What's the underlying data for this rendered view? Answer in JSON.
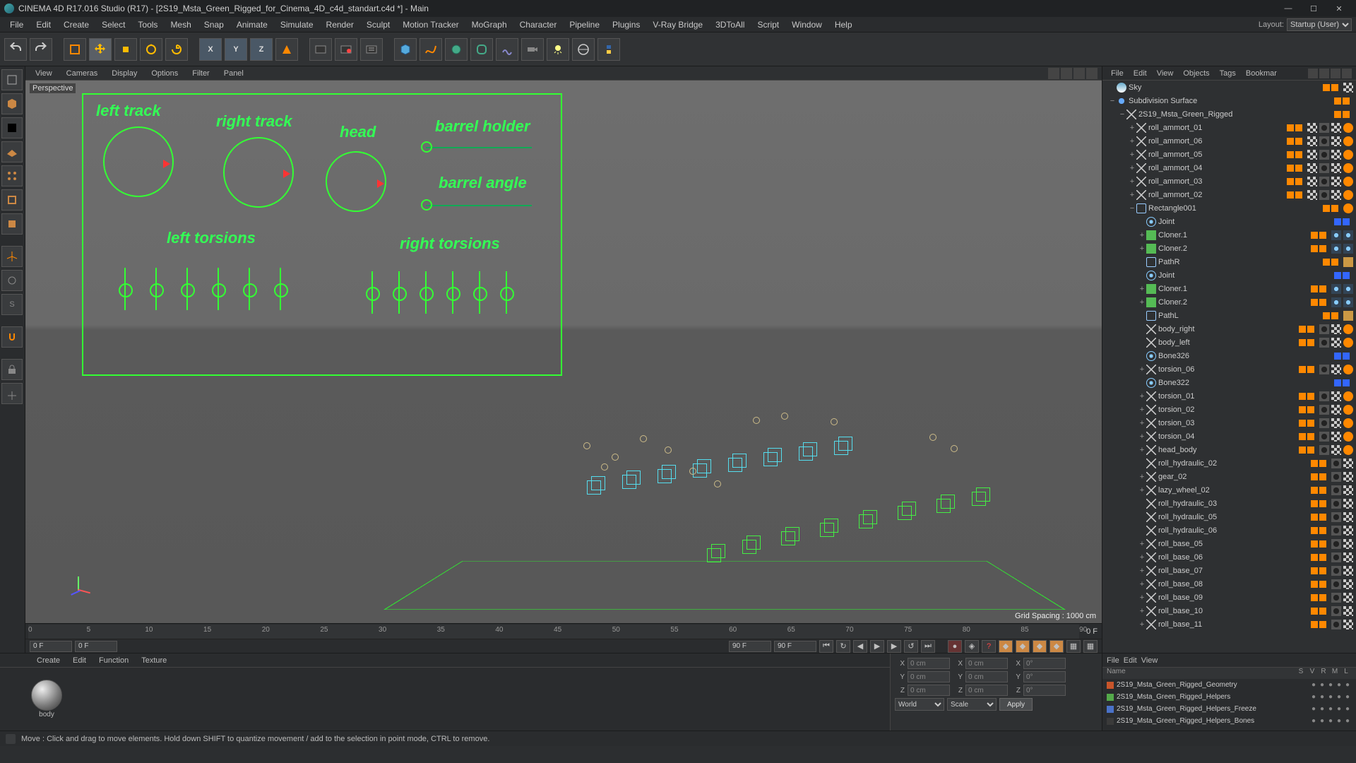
{
  "title": "CINEMA 4D R17.016 Studio (R17) - [2S19_Msta_Green_Rigged_for_Cinema_4D_c4d_standart.c4d *] - Main",
  "menu": [
    "File",
    "Edit",
    "Create",
    "Select",
    "Tools",
    "Mesh",
    "Snap",
    "Animate",
    "Simulate",
    "Render",
    "Sculpt",
    "Motion Tracker",
    "MoGraph",
    "Character",
    "Pipeline",
    "Plugins",
    "V-Ray Bridge",
    "3DToAll",
    "Script",
    "Window",
    "Help"
  ],
  "layout_label": "Layout:",
  "layout_value": "Startup (User)",
  "viewmenu": [
    "View",
    "Cameras",
    "Display",
    "Options",
    "Filter",
    "Panel"
  ],
  "viewport_label": "Perspective",
  "grid_spacing": "Grid Spacing : 1000 cm",
  "hud": {
    "left_track": "left track",
    "right_track": "right track",
    "head": "head",
    "barrel_holder": "barrel holder",
    "barrel_angle": "barrel angle",
    "left_torsions": "left torsions",
    "right_torsions": "right torsions"
  },
  "timeline": {
    "start": 0,
    "end": 90,
    "ticks": [
      0,
      5,
      10,
      15,
      20,
      25,
      30,
      35,
      40,
      45,
      50,
      55,
      60,
      65,
      70,
      75,
      80,
      85,
      90
    ],
    "current": "0 F",
    "range_start": "0 F",
    "range_end": "90 F"
  },
  "playback": [
    "goto-start",
    "key-prev",
    "frame-prev",
    "play",
    "frame-next",
    "key-next",
    "goto-end"
  ],
  "object_tabs": [
    "File",
    "Edit",
    "View",
    "Objects",
    "Tags",
    "Bookmar"
  ],
  "objects": [
    {
      "d": 0,
      "exp": "",
      "icon": "ic-sky",
      "name": "Sky",
      "vis": "o",
      "tags": [
        "tg-checker"
      ]
    },
    {
      "d": 0,
      "exp": "−",
      "icon": "ic-sds",
      "name": "Subdivision Surface",
      "vis": "o",
      "tags": []
    },
    {
      "d": 1,
      "exp": "−",
      "icon": "ic-null",
      "name": "2S19_Msta_Green_Rigged",
      "vis": "o",
      "tags": []
    },
    {
      "d": 2,
      "exp": "+",
      "icon": "ic-null",
      "name": "roll_ammort_01",
      "vis": "o",
      "tags": [
        "tg-checker",
        "tg-dark",
        "tg-checker",
        "tg-orange"
      ]
    },
    {
      "d": 2,
      "exp": "+",
      "icon": "ic-null",
      "name": "roll_ammort_06",
      "vis": "o",
      "tags": [
        "tg-checker",
        "tg-dark",
        "tg-checker",
        "tg-orange"
      ]
    },
    {
      "d": 2,
      "exp": "+",
      "icon": "ic-null",
      "name": "roll_ammort_05",
      "vis": "o",
      "tags": [
        "tg-checker",
        "tg-dark",
        "tg-checker",
        "tg-orange"
      ]
    },
    {
      "d": 2,
      "exp": "+",
      "icon": "ic-null",
      "name": "roll_ammort_04",
      "vis": "o",
      "tags": [
        "tg-checker",
        "tg-dark",
        "tg-checker",
        "tg-orange"
      ]
    },
    {
      "d": 2,
      "exp": "+",
      "icon": "ic-null",
      "name": "roll_ammort_03",
      "vis": "o",
      "tags": [
        "tg-checker",
        "tg-dark",
        "tg-checker",
        "tg-orange"
      ]
    },
    {
      "d": 2,
      "exp": "+",
      "icon": "ic-null",
      "name": "roll_ammort_02",
      "vis": "o",
      "tags": [
        "tg-checker",
        "tg-dark",
        "tg-checker",
        "tg-orange"
      ]
    },
    {
      "d": 2,
      "exp": "−",
      "icon": "ic-spline",
      "name": "Rectangle001",
      "vis": "o",
      "tags": [
        "tg-orange"
      ]
    },
    {
      "d": 3,
      "exp": "",
      "icon": "ic-joint",
      "name": "Joint",
      "vis": "b",
      "tags": []
    },
    {
      "d": 3,
      "exp": "+",
      "icon": "ic-cloner",
      "name": "Cloner.1",
      "vis": "o",
      "tags": [
        "tg-dots",
        "tg-dots"
      ]
    },
    {
      "d": 3,
      "exp": "+",
      "icon": "ic-cloner",
      "name": "Cloner.2",
      "vis": "o",
      "tags": [
        "tg-dots",
        "tg-dots"
      ]
    },
    {
      "d": 3,
      "exp": "",
      "icon": "ic-spline",
      "name": "PathR",
      "vis": "o",
      "tags": [
        "tg-anchor"
      ]
    },
    {
      "d": 3,
      "exp": "",
      "icon": "ic-joint",
      "name": "Joint",
      "vis": "b",
      "tags": []
    },
    {
      "d": 3,
      "exp": "+",
      "icon": "ic-cloner",
      "name": "Cloner.1",
      "vis": "o",
      "tags": [
        "tg-dots",
        "tg-dots"
      ]
    },
    {
      "d": 3,
      "exp": "+",
      "icon": "ic-cloner",
      "name": "Cloner.2",
      "vis": "o",
      "tags": [
        "tg-dots",
        "tg-dots"
      ]
    },
    {
      "d": 3,
      "exp": "",
      "icon": "ic-spline",
      "name": "PathL",
      "vis": "o",
      "tags": [
        "tg-anchor"
      ]
    },
    {
      "d": 3,
      "exp": "",
      "icon": "ic-null",
      "name": "body_right",
      "vis": "o",
      "tags": [
        "tg-dark",
        "tg-checker",
        "tg-orange"
      ]
    },
    {
      "d": 3,
      "exp": "",
      "icon": "ic-null",
      "name": "body_left",
      "vis": "o",
      "tags": [
        "tg-dark",
        "tg-checker",
        "tg-orange"
      ]
    },
    {
      "d": 3,
      "exp": "",
      "icon": "ic-joint",
      "name": "Bone326",
      "vis": "b",
      "tags": []
    },
    {
      "d": 3,
      "exp": "+",
      "icon": "ic-null",
      "name": "torsion_06",
      "vis": "o",
      "tags": [
        "tg-dark",
        "tg-checker",
        "tg-orange"
      ]
    },
    {
      "d": 3,
      "exp": "",
      "icon": "ic-joint",
      "name": "Bone322",
      "vis": "b",
      "tags": []
    },
    {
      "d": 3,
      "exp": "+",
      "icon": "ic-null",
      "name": "torsion_01",
      "vis": "o",
      "tags": [
        "tg-dark",
        "tg-checker",
        "tg-orange"
      ]
    },
    {
      "d": 3,
      "exp": "+",
      "icon": "ic-null",
      "name": "torsion_02",
      "vis": "o",
      "tags": [
        "tg-dark",
        "tg-checker",
        "tg-orange"
      ]
    },
    {
      "d": 3,
      "exp": "+",
      "icon": "ic-null",
      "name": "torsion_03",
      "vis": "o",
      "tags": [
        "tg-dark",
        "tg-checker",
        "tg-orange"
      ]
    },
    {
      "d": 3,
      "exp": "+",
      "icon": "ic-null",
      "name": "torsion_04",
      "vis": "o",
      "tags": [
        "tg-dark",
        "tg-checker",
        "tg-orange"
      ]
    },
    {
      "d": 3,
      "exp": "+",
      "icon": "ic-null",
      "name": "head_body",
      "vis": "o",
      "tags": [
        "tg-dark",
        "tg-checker",
        "tg-orange"
      ]
    },
    {
      "d": 3,
      "exp": "",
      "icon": "ic-null",
      "name": "roll_hydraulic_02",
      "vis": "o",
      "tags": [
        "tg-dark",
        "tg-checker"
      ]
    },
    {
      "d": 3,
      "exp": "+",
      "icon": "ic-null",
      "name": "gear_02",
      "vis": "o",
      "tags": [
        "tg-dark",
        "tg-checker"
      ]
    },
    {
      "d": 3,
      "exp": "+",
      "icon": "ic-null",
      "name": "lazy_wheel_02",
      "vis": "o",
      "tags": [
        "tg-dark",
        "tg-checker"
      ]
    },
    {
      "d": 3,
      "exp": "",
      "icon": "ic-null",
      "name": "roll_hydraulic_03",
      "vis": "o",
      "tags": [
        "tg-dark",
        "tg-checker"
      ]
    },
    {
      "d": 3,
      "exp": "",
      "icon": "ic-null",
      "name": "roll_hydraulic_05",
      "vis": "o",
      "tags": [
        "tg-dark",
        "tg-checker"
      ]
    },
    {
      "d": 3,
      "exp": "",
      "icon": "ic-null",
      "name": "roll_hydraulic_06",
      "vis": "o",
      "tags": [
        "tg-dark",
        "tg-checker"
      ]
    },
    {
      "d": 3,
      "exp": "+",
      "icon": "ic-null",
      "name": "roll_base_05",
      "vis": "o",
      "tags": [
        "tg-dark",
        "tg-checker"
      ]
    },
    {
      "d": 3,
      "exp": "+",
      "icon": "ic-null",
      "name": "roll_base_06",
      "vis": "o",
      "tags": [
        "tg-dark",
        "tg-checker"
      ]
    },
    {
      "d": 3,
      "exp": "+",
      "icon": "ic-null",
      "name": "roll_base_07",
      "vis": "o",
      "tags": [
        "tg-dark",
        "tg-checker"
      ]
    },
    {
      "d": 3,
      "exp": "+",
      "icon": "ic-null",
      "name": "roll_base_08",
      "vis": "o",
      "tags": [
        "tg-dark",
        "tg-checker"
      ]
    },
    {
      "d": 3,
      "exp": "+",
      "icon": "ic-null",
      "name": "roll_base_09",
      "vis": "o",
      "tags": [
        "tg-dark",
        "tg-checker"
      ]
    },
    {
      "d": 3,
      "exp": "+",
      "icon": "ic-null",
      "name": "roll_base_10",
      "vis": "o",
      "tags": [
        "tg-dark",
        "tg-checker"
      ]
    },
    {
      "d": 3,
      "exp": "+",
      "icon": "ic-null",
      "name": "roll_base_11",
      "vis": "o",
      "tags": [
        "tg-dark",
        "tg-checker"
      ]
    }
  ],
  "mat_menu": [
    "Create",
    "Edit",
    "Function",
    "Texture"
  ],
  "material_name": "body",
  "coords": {
    "X": "0 cm",
    "Y": "0 cm",
    "Z": "0 cm",
    "sX": "0 cm",
    "sY": "0 cm",
    "sZ": "0 cm",
    "rX": "0°",
    "rY": "0°",
    "rZ": "0°",
    "world": "World",
    "scale": "Scale",
    "apply": "Apply"
  },
  "layer_tabs": [
    "File",
    "Edit",
    "View"
  ],
  "layer_cols": [
    "Name",
    "S",
    "V",
    "R",
    "M",
    "L"
  ],
  "layers": [
    {
      "color": "#c8552a",
      "name": "2S19_Msta_Green_Rigged_Geometry"
    },
    {
      "color": "#54aa4a",
      "name": "2S19_Msta_Green_Rigged_Helpers"
    },
    {
      "color": "#4a72c8",
      "name": "2S19_Msta_Green_Rigged_Helpers_Freeze"
    },
    {
      "color": "#3a3a3a",
      "name": "2S19_Msta_Green_Rigged_Helpers_Bones"
    }
  ],
  "status": "Move : Click and drag to move elements. Hold down SHIFT to quantize movement / add to the selection in point mode, CTRL to remove."
}
